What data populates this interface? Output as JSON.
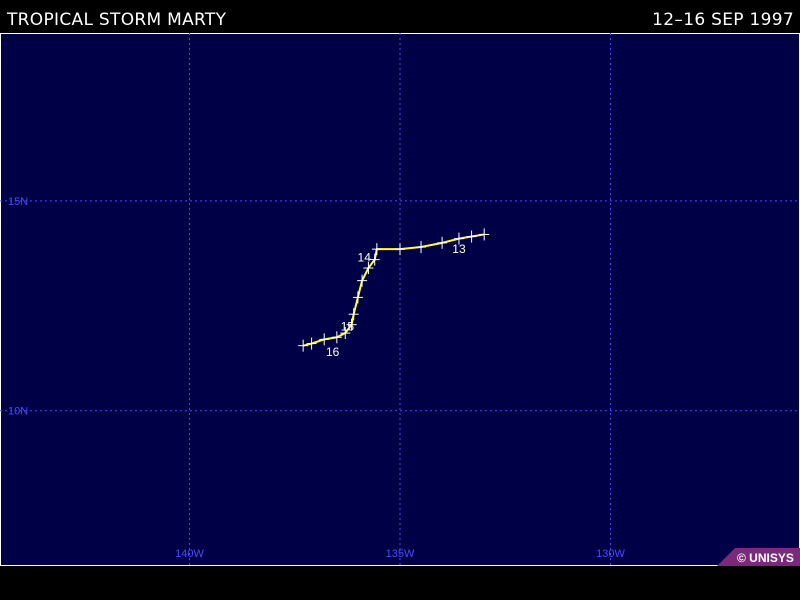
{
  "header": {
    "title": "TROPICAL STORM MARTY",
    "dates": "12–16 SEP 1997"
  },
  "map": {
    "background_color": "#000047",
    "grid_color": "#4a4aff",
    "track_color": "#ffff33",
    "lon_labels": [
      "140W",
      "135W",
      "130W"
    ],
    "lat_labels": [
      "15N",
      "10N"
    ],
    "grid_lons": [
      -140,
      -135,
      -130
    ],
    "grid_lats": [
      15,
      10
    ],
    "lon_range": [
      -144.5,
      -125.5
    ],
    "lat_range": [
      6.3,
      19.0
    ],
    "track": [
      {
        "lon": -133.0,
        "lat": 14.2
      },
      {
        "lon": -133.3,
        "lat": 14.15
      },
      {
        "lon": -133.6,
        "lat": 14.1
      },
      {
        "lon": -134.0,
        "lat": 14.0
      },
      {
        "lon": -134.5,
        "lat": 13.9
      },
      {
        "lon": -135.0,
        "lat": 13.85
      },
      {
        "lon": -135.55,
        "lat": 13.85
      },
      {
        "lon": -135.6,
        "lat": 13.6
      },
      {
        "lon": -135.75,
        "lat": 13.4
      },
      {
        "lon": -135.9,
        "lat": 13.1
      },
      {
        "lon": -136.0,
        "lat": 12.7
      },
      {
        "lon": -136.1,
        "lat": 12.3
      },
      {
        "lon": -136.15,
        "lat": 12.05
      },
      {
        "lon": -136.3,
        "lat": 11.85
      },
      {
        "lon": -136.5,
        "lat": 11.75
      },
      {
        "lon": -136.8,
        "lat": 11.7
      },
      {
        "lon": -137.1,
        "lat": 11.6
      },
      {
        "lon": -137.3,
        "lat": 11.55
      }
    ],
    "day_labels": [
      {
        "text": "13",
        "lon": -133.6,
        "lat": 13.9
      },
      {
        "text": "14",
        "lon": -135.85,
        "lat": 13.7
      },
      {
        "text": "15",
        "lon": -136.25,
        "lat": 12.05
      },
      {
        "text": "16",
        "lon": -136.6,
        "lat": 11.45
      }
    ]
  },
  "footer": {
    "logo_text": "© UNISYS",
    "logo_color": "#7a2a7a"
  }
}
